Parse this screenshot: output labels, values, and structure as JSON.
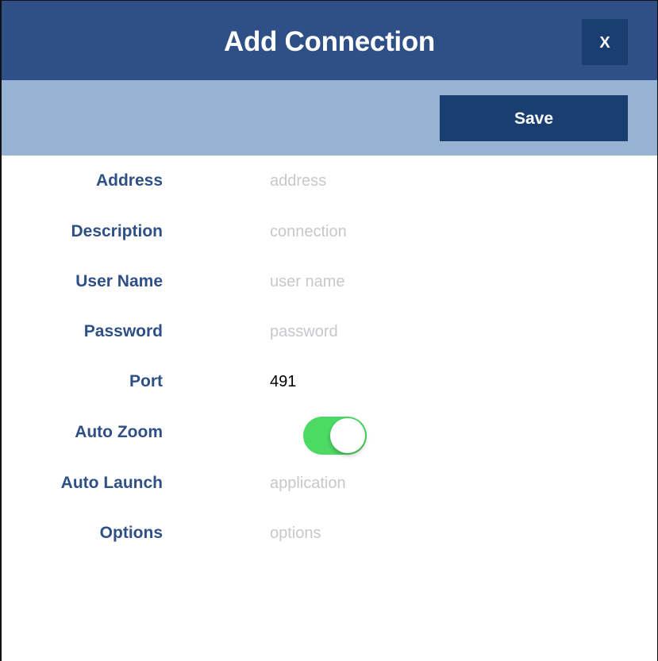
{
  "dialog": {
    "title": "Add Connection",
    "close_label": "X"
  },
  "toolbar": {
    "save_label": "Save"
  },
  "form": {
    "address": {
      "label": "Address",
      "placeholder": "address",
      "value": ""
    },
    "description": {
      "label": "Description",
      "placeholder": "connection",
      "value": ""
    },
    "user_name": {
      "label": "User Name",
      "placeholder": "user name",
      "value": ""
    },
    "password": {
      "label": "Password",
      "placeholder": "password",
      "value": ""
    },
    "port": {
      "label": "Port",
      "placeholder": "",
      "value": "491"
    },
    "auto_zoom": {
      "label": "Auto Zoom",
      "enabled": true
    },
    "auto_launch": {
      "label": "Auto Launch",
      "placeholder": "application",
      "value": ""
    },
    "options": {
      "label": "Options",
      "placeholder": "options",
      "value": ""
    }
  },
  "colors": {
    "title_bar": "#2e5087",
    "toolbar": "#97b3d4",
    "button": "#1a3e6f",
    "label": "#2e5087",
    "toggle_on": "#4cd964",
    "placeholder": "#c7c7cc"
  }
}
